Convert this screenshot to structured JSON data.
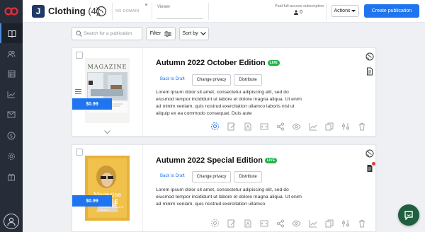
{
  "colors": {
    "rail_bg": "#262d38",
    "accent": "#1f74f0",
    "live_badge": "#24b24a",
    "logo_red": "#e02f3a",
    "chat_bubble": "#1f5f3e"
  },
  "sidebar": {
    "items": [
      {
        "icon": "book-icon",
        "active": true
      },
      {
        "icon": "users-icon"
      },
      {
        "icon": "table-icon"
      },
      {
        "icon": "analytics-chart-icon"
      },
      {
        "icon": "mail-icon"
      },
      {
        "icon": "dollar-icon"
      },
      {
        "icon": "gear-icon"
      },
      {
        "icon": "gift-icon"
      }
    ],
    "avatar_icon": "user-avatar-icon"
  },
  "header": {
    "logo_letter": "J",
    "title": "Clothing",
    "count": "(4)",
    "domain_text": "NO DOMAIN",
    "viewer_label": "Viewer",
    "paid_label": "Paid full-access subscription",
    "paid_count": "0",
    "actions_label": "Actions",
    "create_label": "Create publication"
  },
  "toolbar": {
    "search_placeholder": "Search for a publication",
    "filter_label": "Filter",
    "sort_label": "Sort by"
  },
  "publications": [
    {
      "title": "Autumn 2022 October Edition",
      "status": "LIVE",
      "price": "$0.99",
      "cover_title": "MAGAZINE",
      "back_to_draft": "Back to Draft",
      "change_privacy": "Change privacy",
      "distribute": "Distribute",
      "description": "Lorem ipsum dolor sit amet, consectetur adipiscing elit, sed do eiusmod tempor incididunt ut labore et dolore magna aliqua. Ut enim ad minim veniam, quis nostrud exercitation ullamco laboris nisi ut aliquip ex ea commodo consequat. Duis aute"
    },
    {
      "title": "Autumn 2022 Special Edition",
      "status": "LIVE",
      "price": "$0.99",
      "cover_title": "Magazine",
      "cover_subtitle": "PERFECT MODEL EXCLUSIVE TRENDS OF FASHION",
      "back_to_draft": "Back to Draft",
      "change_privacy": "Change privacy",
      "distribute": "Distribute",
      "description": "Lorem ipsum dolor sit amet, consectetur adipiscing elit, sed do eiusmod tempor incididunt ut labore et dolore magna aliqua. Ut enim ad minim veniam, quis nostrud exercitation ullamco"
    }
  ]
}
